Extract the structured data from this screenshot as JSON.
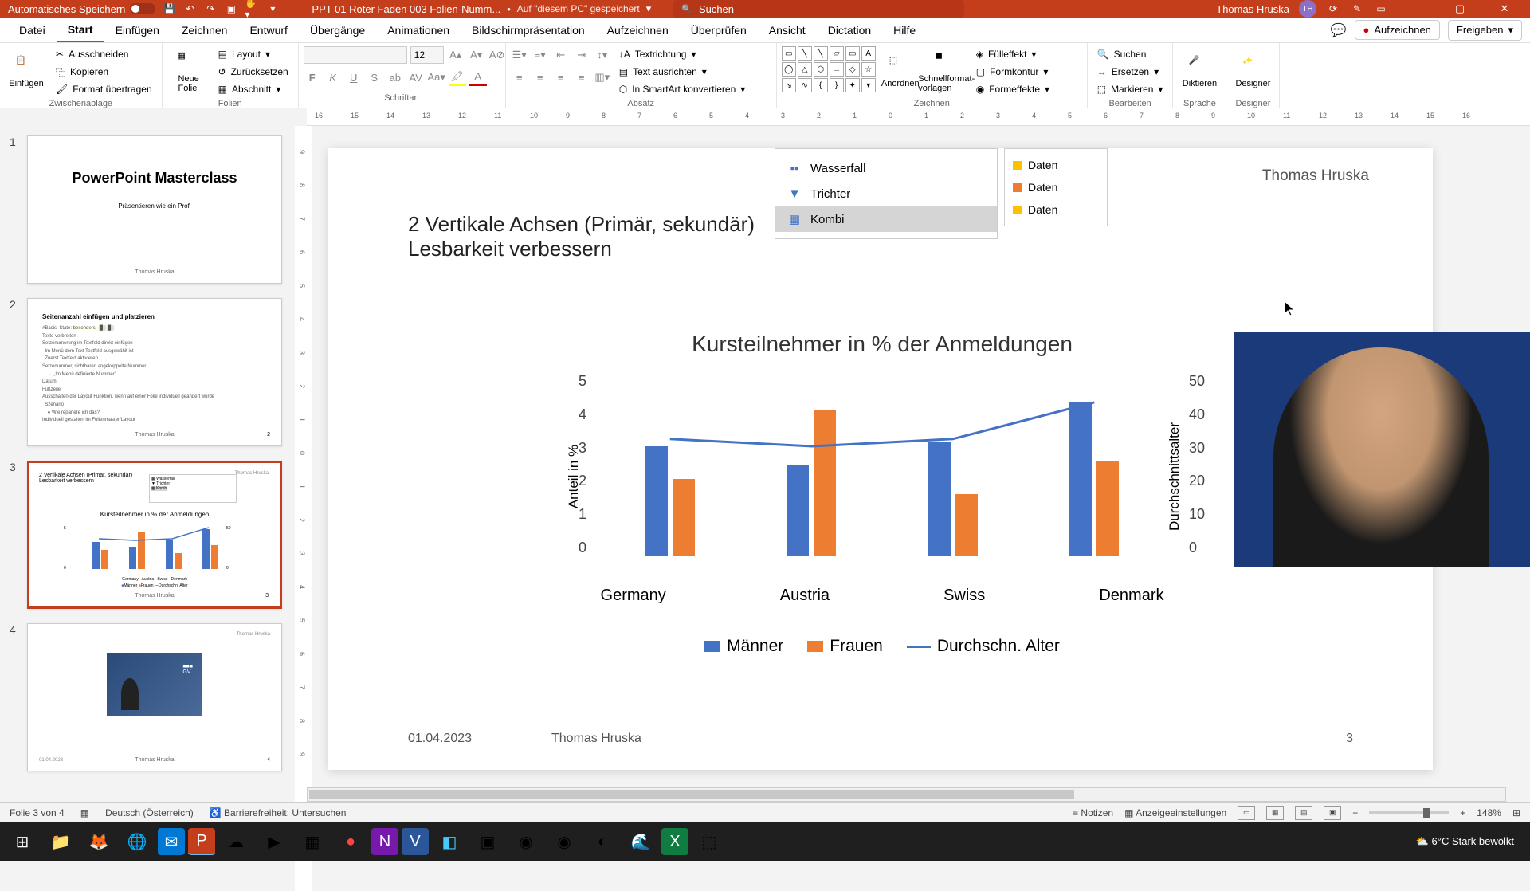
{
  "titlebar": {
    "autosave": "Automatisches Speichern",
    "doc": "PPT 01 Roter Faden 003 Folien-Numm...",
    "saved": "Auf \"diesem PC\" gespeichert",
    "search_ph": "Suchen",
    "user": "Thomas Hruska",
    "initials": "TH"
  },
  "menu": {
    "datei": "Datei",
    "start": "Start",
    "einfuegen": "Einfügen",
    "zeichnen": "Zeichnen",
    "entwurf": "Entwurf",
    "uebergaenge": "Übergänge",
    "animationen": "Animationen",
    "bildschirm": "Bildschirmpräsentation",
    "aufzeichnen": "Aufzeichnen",
    "ueberpruefen": "Überprüfen",
    "ansicht": "Ansicht",
    "dictation": "Dictation",
    "hilfe": "Hilfe",
    "record": "Aufzeichnen",
    "freigeben": "Freigeben"
  },
  "ribbon": {
    "zwischenablage": {
      "label": "Zwischenablage",
      "einfuegen": "Einfügen",
      "ausschneiden": "Ausschneiden",
      "kopieren": "Kopieren",
      "format": "Format übertragen"
    },
    "folien": {
      "label": "Folien",
      "neue": "Neue\nFolie",
      "layout": "Layout",
      "zuruecksetzen": "Zurücksetzen",
      "abschnitt": "Abschnitt"
    },
    "schriftart": {
      "label": "Schriftart",
      "size": "12"
    },
    "absatz": {
      "label": "Absatz",
      "textrichtung": "Textrichtung",
      "textausrichten": "Text ausrichten",
      "smartart": "In SmartArt konvertieren"
    },
    "zeichnen": {
      "label": "Zeichnen",
      "anordnen": "Anordnen",
      "schnellformat": "Schnellformat-\nvorlagen",
      "fuelleffekt": "Fülleffekt",
      "formkontur": "Formkontur",
      "formeffekte": "Formeffekte"
    },
    "bearbeiten": {
      "label": "Bearbeiten",
      "suchen": "Suchen",
      "ersetzen": "Ersetzen",
      "markieren": "Markieren"
    },
    "sprache": {
      "label": "Sprache",
      "diktieren": "Diktieren"
    },
    "designer": {
      "label": "Designer",
      "designer": "Designer"
    }
  },
  "thumbs": {
    "s1": {
      "title": "PowerPoint Masterclass",
      "sub": "Präsentieren wie ein Profi",
      "author": "Thomas Hruska"
    },
    "s2": {
      "title": "Seitenanzahl einfügen und platzieren",
      "author": "Thomas Hruska"
    },
    "s3": {
      "title": "2 Vertikale Achsen (Primär, sekundär)",
      "chart": "Kursteilnehmer in % der Anmeldungen",
      "author": "Thomas Hruska"
    },
    "s4": {
      "author": "Thomas Hruska"
    }
  },
  "slide": {
    "author_tr": "Thomas Hruska",
    "heading_l1": "2 Vertikale Achsen (Primär, sekundär)",
    "heading_l2": "Lesbarkeit verbessern",
    "chart_types": {
      "wasserfall": "Wasserfall",
      "trichter": "Trichter",
      "kombi": "Kombi"
    },
    "legend_preview": {
      "d1": "Daten",
      "d2": "Daten",
      "d3": "Daten"
    },
    "footer": {
      "date": "01.04.2023",
      "author": "Thomas Hruska",
      "num": "3"
    }
  },
  "chart_data": {
    "type": "bar",
    "title": "Kursteilnehmer in % der Anmeldungen",
    "categories": [
      "Germany",
      "Austria",
      "Swiss",
      "Denmark"
    ],
    "series": [
      {
        "name": "Männer",
        "values": [
          3.0,
          2.5,
          3.1,
          4.2
        ],
        "color": "#4472c4"
      },
      {
        "name": "Frauen",
        "values": [
          2.1,
          4.0,
          1.7,
          2.6
        ],
        "color": "#ed7d31"
      }
    ],
    "line_series": {
      "name": "Durchschn. Alter",
      "values": [
        32,
        30,
        32,
        42
      ],
      "color": "#4472c4"
    },
    "ylabel_left": "Anteil in %",
    "ylim_left": [
      0,
      5
    ],
    "ylabel_right": "Durchschnittsalter",
    "ylim_right": [
      0,
      50
    ]
  },
  "legend": {
    "m": "Männer",
    "f": "Frauen",
    "line": "Durchschn. Alter"
  },
  "statusbar": {
    "slide": "Folie 3 von 4",
    "lang": "Deutsch (Österreich)",
    "access": "Barrierefreiheit: Untersuchen",
    "notizen": "Notizen",
    "anzeige": "Anzeigeeinstellungen",
    "zoom": "148%"
  },
  "taskbar": {
    "weather": "6°C  Stark bewölkt"
  },
  "ruler_h": [
    "16",
    "15",
    "14",
    "13",
    "12",
    "11",
    "10",
    "9",
    "8",
    "7",
    "6",
    "5",
    "4",
    "3",
    "2",
    "1",
    "0",
    "1",
    "2",
    "3",
    "4",
    "5",
    "6",
    "7",
    "8",
    "9",
    "10",
    "11",
    "12",
    "13",
    "14",
    "15",
    "16"
  ],
  "ruler_v": [
    "9",
    "8",
    "7",
    "6",
    "5",
    "4",
    "3",
    "2",
    "1",
    "0",
    "1",
    "2",
    "3",
    "4",
    "5",
    "6",
    "7",
    "8",
    "9"
  ],
  "y_ticks_l": [
    "5",
    "4",
    "3",
    "2",
    "1",
    "0"
  ],
  "y_ticks_r": [
    "50",
    "40",
    "30",
    "20",
    "10",
    "0"
  ]
}
